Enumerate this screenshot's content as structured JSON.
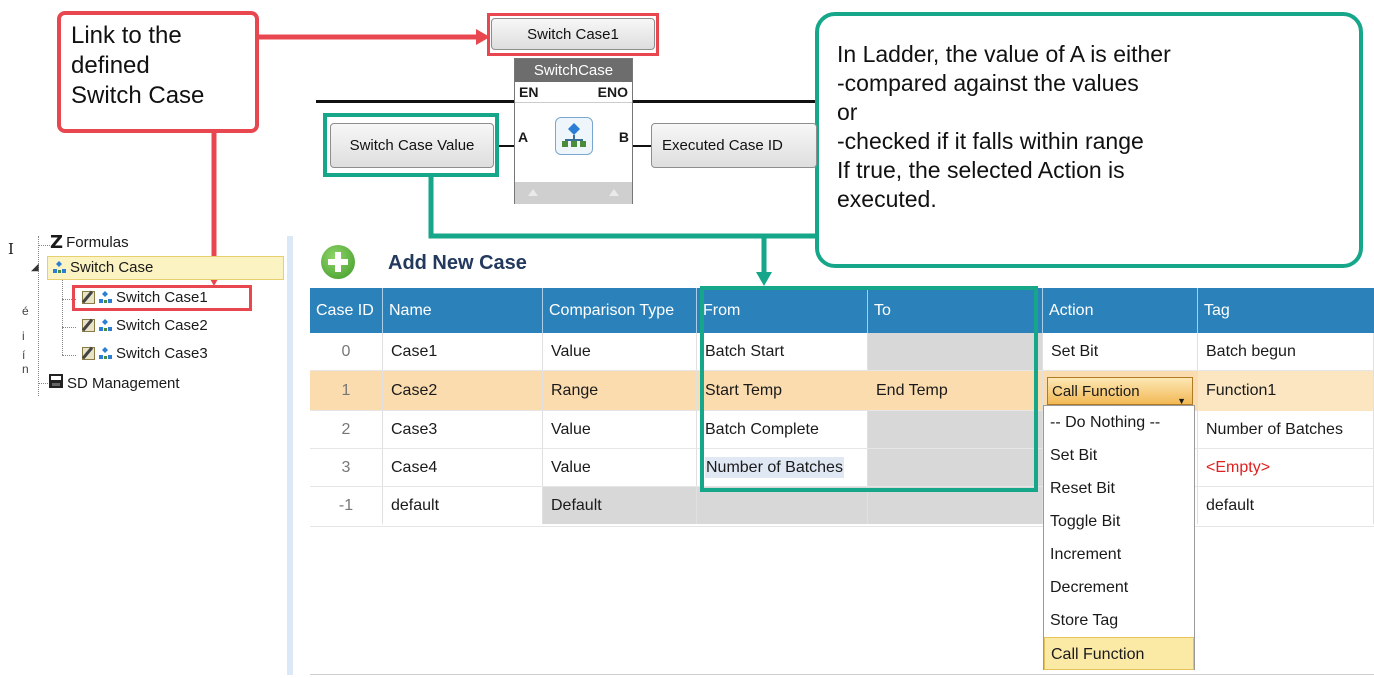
{
  "callouts": {
    "link_lines": [
      "Link to the",
      "defined",
      "Switch Case"
    ],
    "info_lines": [
      "In Ladder, the value of A is  either",
      "-compared against the values",
      "or",
      "-checked if it falls within range",
      "If true, the selected Action is",
      "executed."
    ]
  },
  "ladder": {
    "switch_case_ref": "Switch Case1",
    "block_title": "SwitchCase",
    "en_label": "EN",
    "eno_label": "ENO",
    "input_a_label": "A",
    "output_b_label": "B",
    "input_a_value": "Switch Case Value",
    "output_b_value": "Executed Case ID"
  },
  "tree": {
    "items": [
      {
        "label": "Formulas"
      },
      {
        "label": "Switch Case"
      },
      {
        "label": "Switch Case1"
      },
      {
        "label": "Switch Case2"
      },
      {
        "label": "Switch Case3"
      },
      {
        "label": "SD Management"
      }
    ],
    "edge_letters": [
      "I",
      "é",
      "i",
      "í",
      "n"
    ]
  },
  "add_case_label": "Add New Case",
  "table": {
    "columns": [
      "Case ID",
      "Name",
      "Comparison Type",
      "From",
      "To",
      "Action",
      "Tag"
    ],
    "rows": [
      {
        "id": "0",
        "name": "Case1",
        "type": "Value",
        "from": "Batch Start",
        "to": "",
        "action": "Set Bit",
        "tag": "Batch begun"
      },
      {
        "id": "1",
        "name": "Case2",
        "type": "Range",
        "from": "Start Temp",
        "to": "End Temp",
        "action": "Call Function",
        "tag": "Function1"
      },
      {
        "id": "2",
        "name": "Case3",
        "type": "Value",
        "from": "Batch Complete",
        "to": "",
        "action": "",
        "tag": "Number of Batches"
      },
      {
        "id": "3",
        "name": "Case4",
        "type": "Value",
        "from": "Number of Batches",
        "to": "",
        "action": "",
        "tag": "<Empty>"
      },
      {
        "id": "-1",
        "name": "default",
        "type": "Default",
        "from": "",
        "to": "",
        "action": "",
        "tag": "default"
      }
    ]
  },
  "action_dropdown": {
    "selected": "Call Function",
    "options": [
      "-- Do Nothing --",
      "Set Bit",
      "Reset Bit",
      "Toggle Bit",
      "Increment",
      "Decrement",
      "Store Tag",
      "Call Function"
    ]
  },
  "colors": {
    "callout_red": "#e8474f",
    "callout_green": "#16a78a",
    "header_blue": "#2b82bb",
    "selected_row": "#fbdcae",
    "empty_tag": "#e02020"
  }
}
